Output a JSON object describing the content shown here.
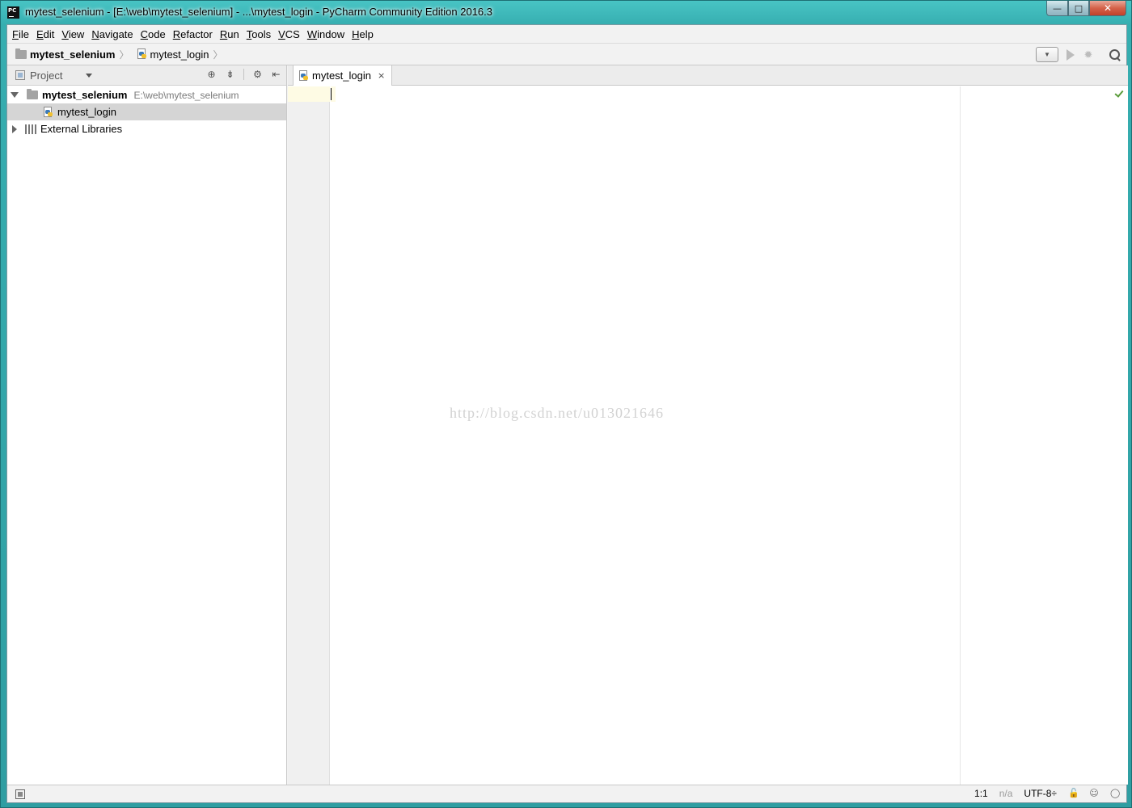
{
  "window": {
    "title": "mytest_selenium - [E:\\web\\mytest_selenium] - ...\\mytest_login - PyCharm Community Edition 2016.3",
    "app_icon_text": "PC",
    "minimize_glyph": "—",
    "maximize_glyph": "□",
    "close_glyph": "✕"
  },
  "menu": [
    {
      "mnemonic": "F",
      "rest": "ile"
    },
    {
      "mnemonic": "E",
      "rest": "dit"
    },
    {
      "mnemonic": "V",
      "rest": "iew"
    },
    {
      "mnemonic": "N",
      "rest": "avigate"
    },
    {
      "mnemonic": "C",
      "rest": "ode"
    },
    {
      "mnemonic": "R",
      "rest": "efactor"
    },
    {
      "mnemonic": "R",
      "rest": "un",
      "pre": "",
      "label_full": "Run"
    },
    {
      "mnemonic": "T",
      "rest": "ools"
    },
    {
      "mnemonic": "V",
      "rest": "CS"
    },
    {
      "mnemonic": "W",
      "rest": "indow"
    },
    {
      "mnemonic": "H",
      "rest": "elp"
    }
  ],
  "breadcrumb": {
    "project": "mytest_selenium",
    "file": "mytest_login",
    "separator": "〉"
  },
  "project_panel": {
    "title": "Project",
    "tree": {
      "root_name": "mytest_selenium",
      "root_path": "E:\\web\\mytest_selenium",
      "file_name": "mytest_login",
      "libraries": "External Libraries"
    }
  },
  "editor": {
    "tab_label": "mytest_login",
    "tab_close": "×",
    "watermark": "http://blog.csdn.net/u013021646"
  },
  "statusbar": {
    "position": "1:1",
    "na": "n/a",
    "encoding": "UTF-8",
    "encoding_arrows": "÷"
  },
  "colors": {
    "window_frame": "#36aeb0",
    "selection": "#d5d5d5",
    "caret_line": "#fefbe4",
    "check_green": "#5a9c3a"
  }
}
